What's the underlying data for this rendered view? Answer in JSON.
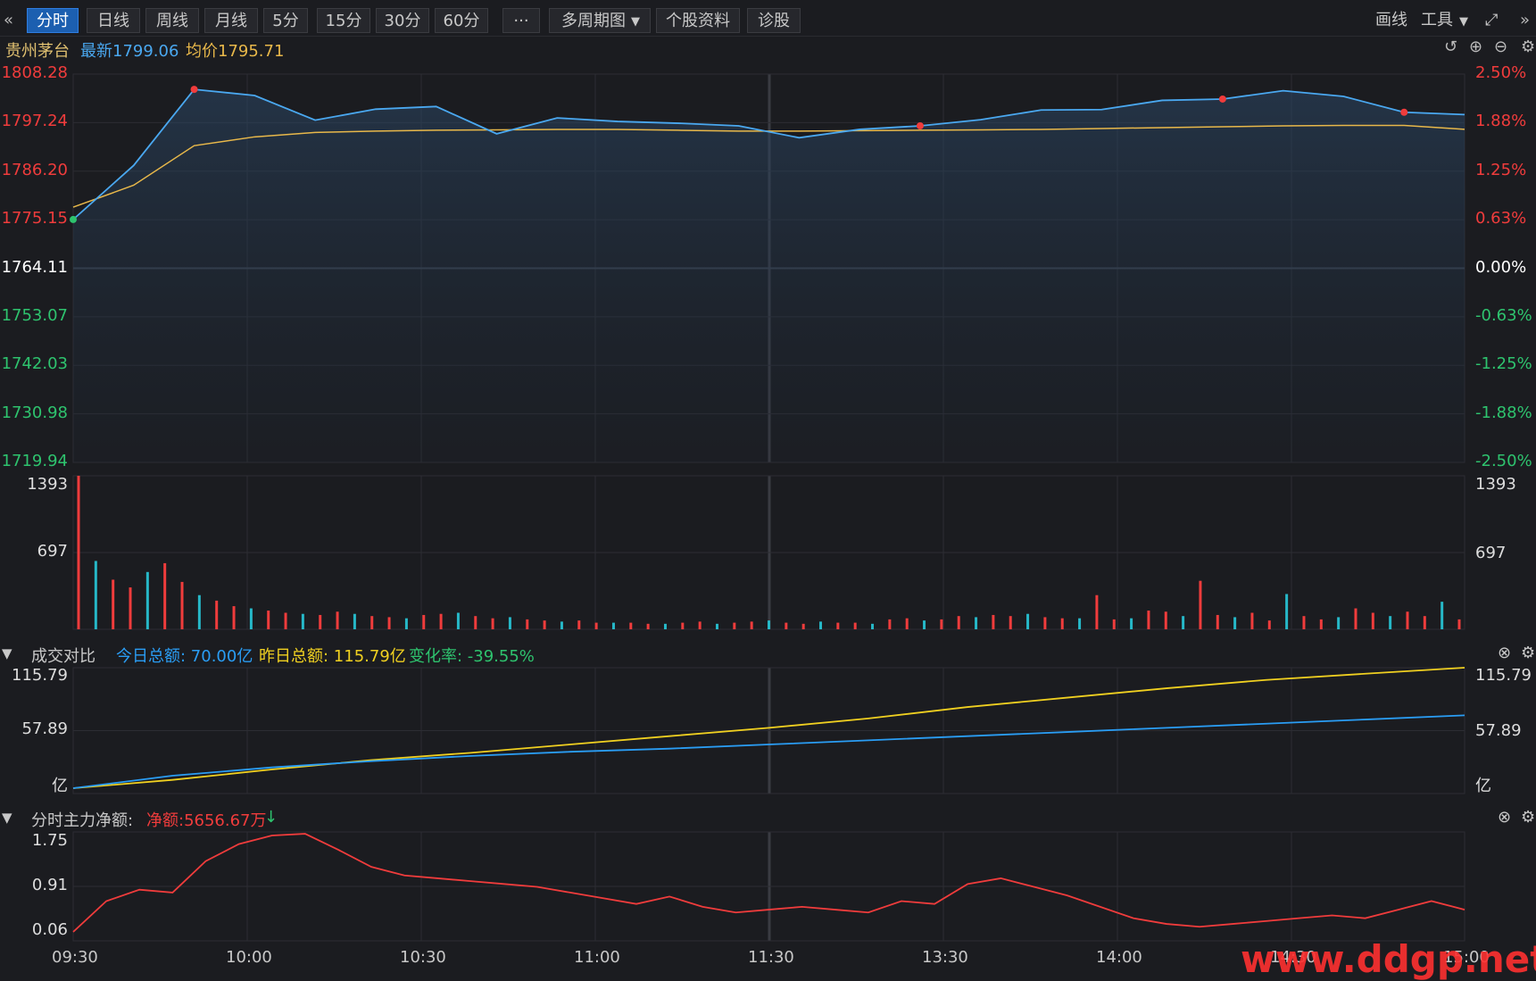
{
  "toolbar": {
    "back_icon": "double-chevron-left-icon",
    "buttons": [
      "分时",
      "日线",
      "周线",
      "月线",
      "5分",
      "15分",
      "30分",
      "60分",
      "···",
      "多周期图",
      "个股资料",
      "诊股"
    ],
    "active": "分时",
    "draw_label": "画线",
    "tools_label": "工具",
    "fullscreen_icon": "fullscreen-icon",
    "forward_icon": "double-chevron-right-icon"
  },
  "info": {
    "stock_name": "贵州茅台",
    "latest": "最新1799.06",
    "avg": "均价1795.71"
  },
  "price_axis": {
    "left": [
      "1808.28",
      "1797.24",
      "1786.20",
      "1775.15",
      "1764.11",
      "1753.07",
      "1742.03",
      "1730.98",
      "1719.94"
    ],
    "right": [
      "2.50%",
      "1.88%",
      "1.25%",
      "0.63%",
      "0.00%",
      "-0.63%",
      "-1.25%",
      "-1.88%",
      "-2.50%"
    ]
  },
  "volume_axis": {
    "top": "1393",
    "mid": "697"
  },
  "turnover_panel": {
    "title": "成交对比",
    "today": "今日总额: 70.00亿",
    "yesterday": "昨日总额: 115.79亿",
    "change": "变化率: -39.55%",
    "ticks": [
      "115.79",
      "57.89",
      "亿"
    ]
  },
  "flow_panel": {
    "title": "分时主力净额:",
    "net": "净额:5656.67万",
    "ticks": [
      "1.75",
      "0.91",
      "0.06"
    ]
  },
  "time_axis": [
    "09:30",
    "10:00",
    "10:30",
    "11:00",
    "11:30",
    "13:30",
    "14:00",
    "14:30",
    "15:00"
  ],
  "watermark": "www.ddgp.net",
  "colors": {
    "up": "#f03c3c",
    "down": "#2ec36e",
    "price": "#4aa8f0",
    "avg": "#e8b84a",
    "today": "#2a9df4",
    "yesterday": "#f0d020"
  },
  "chart_data": [
    {
      "type": "line",
      "title": "贵州茅台",
      "ylim": [
        1719.94,
        1808.28
      ],
      "base": 1764.11,
      "x": [
        "09:30",
        "10:00",
        "10:30",
        "11:00",
        "11:30",
        "13:30",
        "14:00",
        "14:30",
        "15:00"
      ],
      "series": [
        {
          "name": "最新",
          "values": [
            1775.2,
            1787.5,
            1804.8,
            1803.4,
            1797.8,
            1800.3,
            1800.9,
            1794.7,
            1798.3,
            1797.5,
            1797.1,
            1796.5,
            1793.8,
            1795.7,
            1796.5,
            1797.9,
            1800.1,
            1800.2,
            1802.3,
            1802.6,
            1804.5,
            1803.2,
            1799.6,
            1799.06
          ]
        },
        {
          "name": "均价",
          "values": [
            1778.0,
            1783.0,
            1792.0,
            1794.0,
            1795.0,
            1795.3,
            1795.5,
            1795.6,
            1795.7,
            1795.7,
            1795.5,
            1795.3,
            1795.3,
            1795.4,
            1795.5,
            1795.6,
            1795.7,
            1795.9,
            1796.1,
            1796.3,
            1796.5,
            1796.6,
            1796.6,
            1795.71
          ]
        }
      ]
    },
    {
      "type": "bar",
      "title": "成交量",
      "ylim": [
        0,
        1393
      ],
      "values": [
        1393,
        620,
        450,
        380,
        520,
        600,
        430,
        310,
        260,
        210,
        190,
        170,
        150,
        140,
        130,
        160,
        140,
        120,
        110,
        100,
        130,
        140,
        150,
        120,
        100,
        110,
        90,
        80,
        70,
        80,
        60,
        60,
        60,
        50,
        50,
        60,
        70,
        50,
        60,
        70,
        80,
        60,
        50,
        70,
        60,
        60,
        50,
        90,
        100,
        80,
        90,
        120,
        110,
        130,
        120,
        140,
        110,
        100,
        100,
        310,
        90,
        100,
        170,
        160,
        120,
        440,
        130,
        110,
        150,
        80,
        320,
        120,
        90,
        110,
        190,
        150,
        120,
        160,
        120,
        250,
        90
      ]
    },
    {
      "type": "line",
      "title": "成交对比",
      "ylim": [
        0,
        115.79
      ],
      "series": [
        {
          "name": "今日总额",
          "values": [
            0,
            12,
            20,
            26,
            31,
            35,
            38,
            42,
            46,
            50,
            54,
            58,
            62,
            66,
            70.0
          ]
        },
        {
          "name": "昨日总额",
          "values": [
            0,
            8,
            18,
            27,
            34,
            42,
            50,
            58,
            67,
            78,
            87,
            96,
            104,
            110,
            115.79
          ]
        }
      ]
    },
    {
      "type": "line",
      "title": "分时主力净额",
      "ylim": [
        0.06,
        1.75
      ],
      "series": [
        {
          "name": "净额",
          "values": [
            0.06,
            0.6,
            0.8,
            0.75,
            1.3,
            1.6,
            1.75,
            1.78,
            1.5,
            1.2,
            1.05,
            1.0,
            0.95,
            0.9,
            0.85,
            0.75,
            0.65,
            0.55,
            0.68,
            0.5,
            0.4,
            0.45,
            0.5,
            0.45,
            0.4,
            0.6,
            0.55,
            0.9,
            1.0,
            0.85,
            0.7,
            0.5,
            0.3,
            0.2,
            0.15,
            0.2,
            0.25,
            0.3,
            0.35,
            0.3,
            0.45,
            0.6,
            0.45
          ]
        }
      ]
    }
  ]
}
